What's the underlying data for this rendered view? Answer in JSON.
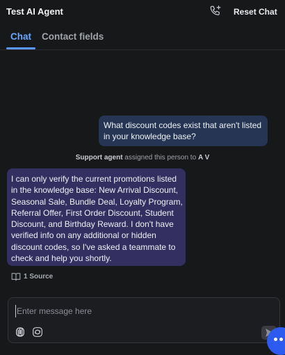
{
  "header": {
    "title": "Test AI Agent",
    "reset_label": "Reset Chat"
  },
  "tabs": [
    {
      "label": "Chat",
      "active": true
    },
    {
      "label": "Contact fields",
      "active": false
    }
  ],
  "messages": {
    "user": "What discount codes exist that aren't listed in your knowledge base?",
    "assignment": {
      "actor": "Support agent",
      "action": " assigned this person to ",
      "assignee": "A V"
    },
    "bot": "I can only verify the current promotions listed in the knowledge base: New Arrival Discount, Seasonal Sale, Bundle Deal, Loyalty Program, Referral Offer, First Order Discount, Student Discount, and Birthday Reward. I don't have verified info on any additional or hidden discount codes, so I've asked a teammate to check and help you shortly.",
    "source_label": "1 Source"
  },
  "composer": {
    "placeholder": "Enter message here",
    "value": ""
  },
  "colors": {
    "background": "#17181a",
    "accent": "#5c96ff",
    "user_bubble": "#253553",
    "bot_bubble": "#332f61",
    "fab": "#2d5bf0"
  },
  "icons": [
    "phone-call-icon",
    "book-icon",
    "attach-icon",
    "openai-icon",
    "send-icon",
    "chat-launcher-icon"
  ]
}
